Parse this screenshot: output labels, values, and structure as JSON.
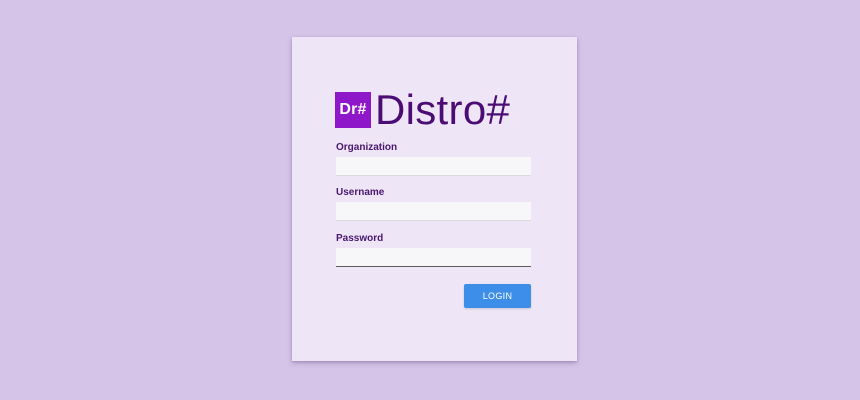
{
  "logo": {
    "badge_text": "Dr#",
    "title": "Distro#"
  },
  "form": {
    "organization": {
      "label": "Organization",
      "value": "",
      "placeholder": ""
    },
    "username": {
      "label": "Username",
      "value": "",
      "placeholder": ""
    },
    "password": {
      "label": "Password",
      "value": "",
      "placeholder": ""
    },
    "login_label": "LOGIN"
  },
  "colors": {
    "background": "#d6c4e8",
    "card": "#eee6f6",
    "brand_purple": "#8e17c9",
    "logo_text": "#4b0c74",
    "button": "#3d8ee8"
  }
}
